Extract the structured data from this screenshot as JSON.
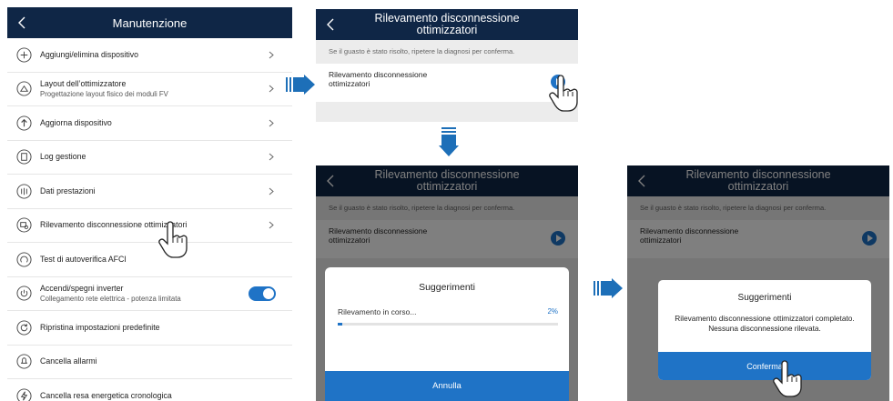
{
  "panel_a": {
    "title": "Manutenzione",
    "items": [
      {
        "label": "Aggiungi/elimina dispositivo",
        "sub": "",
        "icon": "plus-circle-icon",
        "control": "chevron"
      },
      {
        "label": "Layout dell’ottimizzatore",
        "sub": "Progettazione layout fisico dei moduli FV",
        "icon": "layout-icon",
        "control": "chevron"
      },
      {
        "label": "Aggiorna dispositivo",
        "sub": "",
        "icon": "upgrade-icon",
        "control": "chevron"
      },
      {
        "label": "Log gestione",
        "sub": "",
        "icon": "log-icon",
        "control": "chevron"
      },
      {
        "label": "Dati prestazioni",
        "sub": "",
        "icon": "performance-icon",
        "control": "chevron"
      },
      {
        "label": "Rilevamento disconnessione ottimizzatori",
        "sub": "",
        "icon": "optimizer-detect-icon",
        "control": "chevron"
      },
      {
        "label": "Test di autoverifica AFCI",
        "sub": "",
        "icon": "afci-icon",
        "control": "none"
      },
      {
        "label": "Accendi/spegni inverter",
        "sub": "Collegamento rete elettrica - potenza limitata",
        "icon": "power-icon",
        "control": "toggle-on"
      },
      {
        "label": "Ripristina impostazioni predefinite",
        "sub": "",
        "icon": "reset-icon",
        "control": "none"
      },
      {
        "label": "Cancella allarmi",
        "sub": "",
        "icon": "alarm-icon",
        "control": "none"
      },
      {
        "label": "Cancella resa energetica cronologica",
        "sub": "",
        "icon": "energy-icon",
        "control": "none"
      }
    ]
  },
  "panel_b": {
    "title": "Rilevamento disconnessione ottimizzatori",
    "hint": "Se il guasto è stato risolto, ripetere la diagnosi per conferma.",
    "item_label": "Rilevamento disconnessione ottimizzatori"
  },
  "panel_c": {
    "title": "Rilevamento disconnessione ottimizzatori",
    "hint": "Se il guasto è stato risolto, ripetere la diagnosi per conferma.",
    "item_label": "Rilevamento disconnessione ottimizzatori",
    "dialog_title": "Suggerimenti",
    "progress_text": "Rilevamento in corso...",
    "progress_percent_label": "2%",
    "progress_value": 0.02,
    "button": "Annulla"
  },
  "panel_d": {
    "title": "Rilevamento disconnessione ottimizzatori",
    "hint": "Se il guasto è stato risolto, ripetere la diagnosi per conferma.",
    "item_label": "Rilevamento disconnessione ottimizzatori",
    "dialog_title": "Suggerimenti",
    "message": "Rilevamento disconnessione ottimizzatori completato. Nessuna disconnessione rilevata.",
    "button": "Conferma"
  },
  "colors": {
    "navbar": "#0f2646",
    "accent": "#1f73c6",
    "arrow": "#1d6fb8"
  }
}
